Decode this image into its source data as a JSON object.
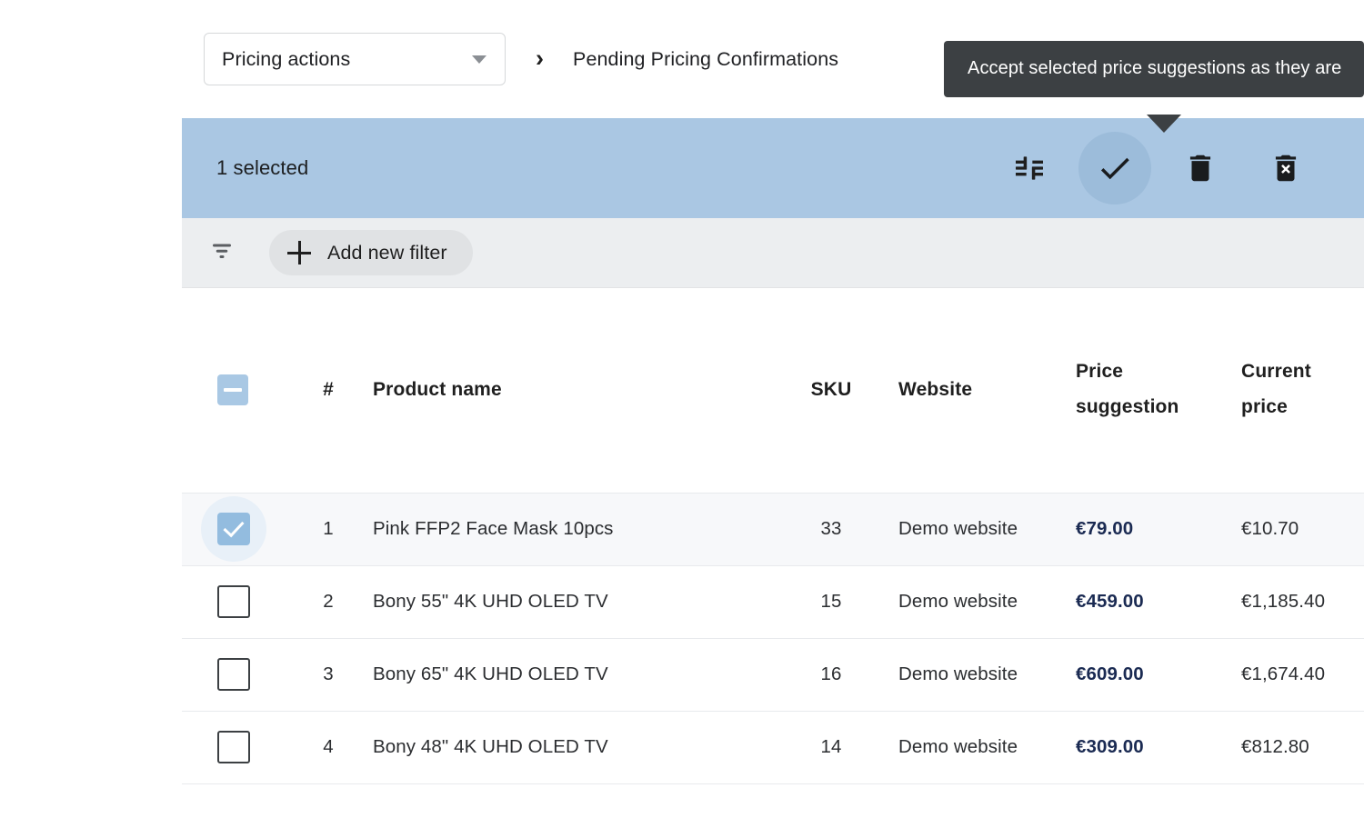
{
  "topbar": {
    "select": {
      "value": "Pricing actions",
      "icon": "chevron-down-icon"
    },
    "breadcrumb_separator": "›",
    "breadcrumb_current": "Pending Pricing Confirmations"
  },
  "tooltip": {
    "text": "Accept selected price suggestions as they are"
  },
  "action_bar": {
    "selected_label": "1 selected",
    "background_color": "#aac7e3",
    "buttons": [
      {
        "name": "tune-icon",
        "label": "Adjust price suggestions",
        "hovered": false
      },
      {
        "name": "check-icon",
        "label": "Accept selected price suggestions as they are",
        "hovered": true
      },
      {
        "name": "trash-icon",
        "label": "Delete selected",
        "hovered": false
      },
      {
        "name": "delete-forever-icon",
        "label": "Delete selected forever",
        "hovered": false
      }
    ]
  },
  "filter_bar": {
    "filter_icon": "filter-list-icon",
    "add_filter_label": "Add new filter",
    "add_filter_icon": "plus-icon"
  },
  "table": {
    "header_checkbox_state": "indeterminate",
    "columns": [
      {
        "key": "check",
        "label": ""
      },
      {
        "key": "num",
        "label": "#"
      },
      {
        "key": "name",
        "label": "Product name"
      },
      {
        "key": "sku",
        "label": "SKU"
      },
      {
        "key": "website",
        "label": "Website"
      },
      {
        "key": "suggestion",
        "label_line1": "Price",
        "label_line2": "suggestion"
      },
      {
        "key": "current",
        "label_line1": "Current",
        "label_line2": "price"
      }
    ],
    "rows": [
      {
        "checked": true,
        "hovered": true,
        "num": "1",
        "name": "Pink FFP2 Face Mask 10pcs",
        "sku": "33",
        "website": "Demo website",
        "suggestion": "€79.00",
        "current": "€10.70"
      },
      {
        "checked": false,
        "hovered": false,
        "num": "2",
        "name": "Bony 55\" 4K UHD OLED TV",
        "sku": "15",
        "website": "Demo website",
        "suggestion": "€459.00",
        "current": "€1,185.40"
      },
      {
        "checked": false,
        "hovered": false,
        "num": "3",
        "name": "Bony 65\" 4K UHD OLED TV",
        "sku": "16",
        "website": "Demo website",
        "suggestion": "€609.00",
        "current": "€1,674.40"
      },
      {
        "checked": false,
        "hovered": false,
        "num": "4",
        "name": "Bony 48\" 4K UHD OLED TV",
        "sku": "14",
        "website": "Demo website",
        "suggestion": "€309.00",
        "current": "€812.80"
      }
    ]
  },
  "colors": {
    "selection_bar": "#aac7e3",
    "tooltip_bg": "#3c4043",
    "price_suggestion_text": "#1a2a52",
    "row_hover": "#f7f8fa",
    "filter_bar_bg": "#eceef0"
  }
}
